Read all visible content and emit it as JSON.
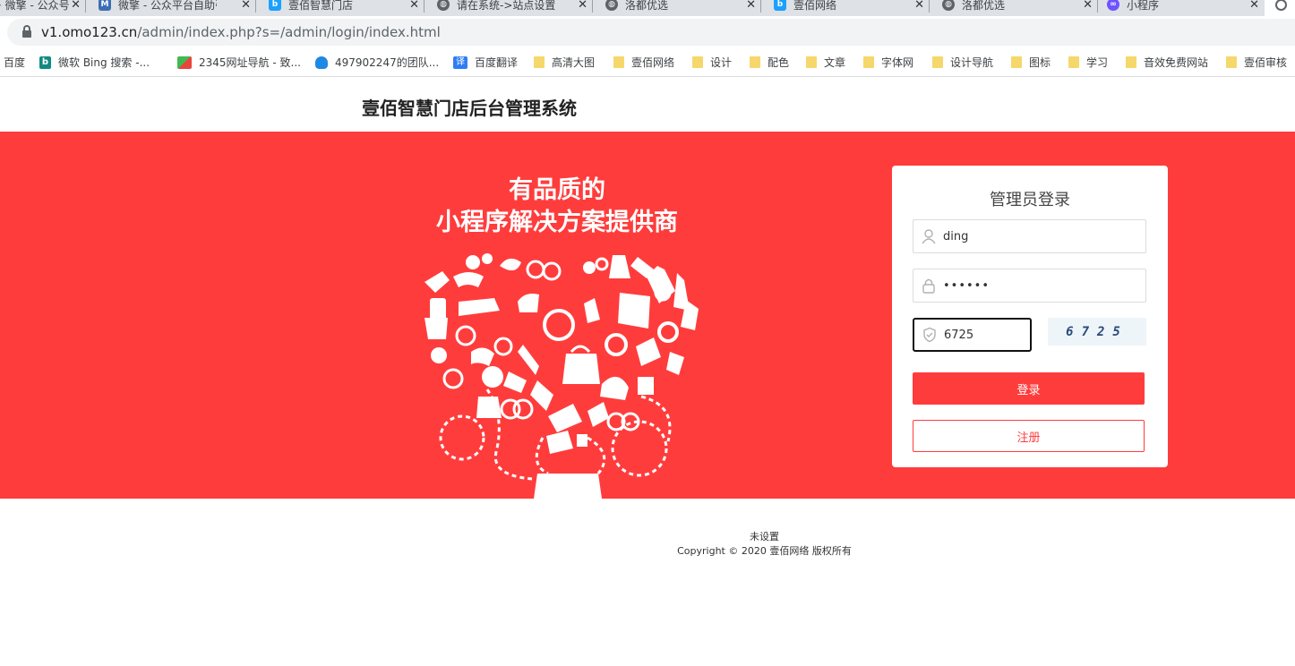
{
  "browser": {
    "tabs": [
      {
        "title": "· 微擎 - 公众号",
        "icon": "",
        "icon_color": "#dee1e6"
      },
      {
        "title": "微擎 - 公众平台自助引擎",
        "icon": "M",
        "icon_color": "#3b6fb6"
      },
      {
        "title": "壹佰智慧门店",
        "icon": "b",
        "icon_color": "#1aa1ff"
      },
      {
        "title": "请在系统->站点设置里",
        "icon": "",
        "icon_color": "#5f6368"
      },
      {
        "title": "洛都优选",
        "icon": "",
        "icon_color": "#5f6368"
      },
      {
        "title": "壹佰网络",
        "icon": "b",
        "icon_color": "#1aa1ff"
      },
      {
        "title": "洛都优选",
        "icon": "",
        "icon_color": "#5f6368"
      },
      {
        "title": "小程序",
        "icon": "",
        "icon_color": "#6f52ff"
      }
    ],
    "url_host": "v1.omo123.cn",
    "url_path": "/admin/index.php?s=/admin/login/index.html",
    "bookmarks": [
      {
        "label": "百度",
        "icon": "none"
      },
      {
        "label": "微软 Bing 搜索 -...",
        "icon": "bing"
      },
      {
        "label": "2345网址导航 - 致...",
        "icon": "2345"
      },
      {
        "label": "497902247的团队...",
        "icon": "qq"
      },
      {
        "label": "百度翻译",
        "icon": "translate"
      },
      {
        "label": "高清大图",
        "icon": "folder"
      },
      {
        "label": "壹佰网络",
        "icon": "folder"
      },
      {
        "label": "设计",
        "icon": "folder"
      },
      {
        "label": "配色",
        "icon": "folder"
      },
      {
        "label": "文章",
        "icon": "folder"
      },
      {
        "label": "字体网",
        "icon": "folder"
      },
      {
        "label": "设计导航",
        "icon": "folder"
      },
      {
        "label": "图标",
        "icon": "folder"
      },
      {
        "label": "学习",
        "icon": "folder"
      },
      {
        "label": "音效免费网站",
        "icon": "folder"
      },
      {
        "label": "壹佰审核",
        "icon": "folder"
      }
    ]
  },
  "header": {
    "title": "壹佰智慧门店后台管理系统"
  },
  "hero": {
    "slogan_line1": "有品质的",
    "slogan_line2": "小程序解决方案提供商",
    "background_color": "#ff3c3c"
  },
  "login": {
    "title": "管理员登录",
    "username": "ding",
    "password": "••••••",
    "captcha_input": "6725",
    "captcha_image_text": "6725",
    "login_button": "登录",
    "register_button": "注册",
    "accent_color": "#ff3c3c"
  },
  "footer": {
    "line1": "未设置",
    "line2": "Copyright © 2020 壹佰网络 版权所有"
  }
}
